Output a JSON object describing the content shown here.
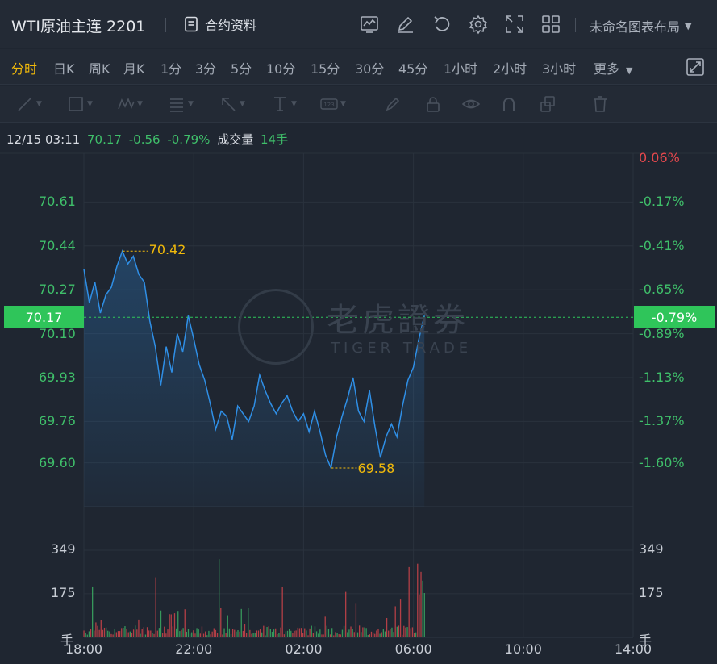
{
  "header": {
    "title": "WTI原油主连 2201",
    "contract_label": "合约资料",
    "layout_label": "未命名图表布局",
    "toolbar_icons": [
      "indicator-chart-icon",
      "edit-icon",
      "undo-icon",
      "settings-icon",
      "expand-icon",
      "grid-layout-icon"
    ]
  },
  "periods": {
    "items": [
      "分时",
      "日K",
      "周K",
      "月K",
      "1分",
      "3分",
      "5分",
      "10分",
      "15分",
      "30分",
      "45分",
      "1小时",
      "2小时",
      "3小时",
      "更多"
    ],
    "active": "分时"
  },
  "drawing_tools": [
    "line-tool-icon",
    "rectangle-tool-icon",
    "pattern-tool-icon",
    "fib-tool-icon",
    "arrow-tool-icon",
    "measure-tool-icon",
    "text-tool-icon",
    "brush-icon",
    "lock-icon",
    "eye-icon",
    "magnet-icon",
    "layers-icon",
    "trash-icon"
  ],
  "info": {
    "datetime": "12/15 03:11",
    "price": "70.17",
    "change": "-0.56",
    "change_pct": "-0.79%",
    "volume_label": "成交量",
    "volume_value": "14手"
  },
  "watermark": {
    "cn": "老虎證券",
    "en": "TIGER TRADE"
  },
  "colors": {
    "up": "#3fbf6a",
    "down": "#e5484d",
    "line": "#2f8fe6",
    "accent": "#f0b90b"
  },
  "chart_data": {
    "type": "line",
    "price_axis_left": [
      "70.61",
      "70.44",
      "70.27",
      "70.10",
      "69.93",
      "69.76",
      "69.60"
    ],
    "price_axis_right": [
      "0.06%",
      "-0.17%",
      "-0.41%",
      "-0.65%",
      "-0.89%",
      "-1.13%",
      "-1.37%",
      "-1.60%"
    ],
    "current_price_label": "70.17",
    "current_pct_label": "-0.79%",
    "high_label": "70.42",
    "low_label": "69.58",
    "ylim": [
      69.43,
      70.78
    ],
    "x_ticks": [
      "18:00",
      "22:00",
      "02:00",
      "06:00",
      "10:00",
      "14:00"
    ],
    "x_range_hours": [
      0,
      20
    ],
    "price_series": [
      [
        0.0,
        70.35
      ],
      [
        0.2,
        70.22
      ],
      [
        0.4,
        70.3
      ],
      [
        0.6,
        70.18
      ],
      [
        0.8,
        70.25
      ],
      [
        1.0,
        70.28
      ],
      [
        1.2,
        70.36
      ],
      [
        1.4,
        70.42
      ],
      [
        1.6,
        70.37
      ],
      [
        1.8,
        70.4
      ],
      [
        2.0,
        70.33
      ],
      [
        2.2,
        70.3
      ],
      [
        2.4,
        70.15
      ],
      [
        2.6,
        70.05
      ],
      [
        2.8,
        69.9
      ],
      [
        3.0,
        70.05
      ],
      [
        3.2,
        69.95
      ],
      [
        3.4,
        70.1
      ],
      [
        3.6,
        70.03
      ],
      [
        3.8,
        70.17
      ],
      [
        4.0,
        70.08
      ],
      [
        4.2,
        69.98
      ],
      [
        4.4,
        69.92
      ],
      [
        4.6,
        69.83
      ],
      [
        4.8,
        69.73
      ],
      [
        5.0,
        69.8
      ],
      [
        5.2,
        69.78
      ],
      [
        5.4,
        69.69
      ],
      [
        5.6,
        69.82
      ],
      [
        5.8,
        69.79
      ],
      [
        6.0,
        69.76
      ],
      [
        6.2,
        69.82
      ],
      [
        6.4,
        69.94
      ],
      [
        6.6,
        69.88
      ],
      [
        6.8,
        69.83
      ],
      [
        7.0,
        69.79
      ],
      [
        7.2,
        69.83
      ],
      [
        7.4,
        69.86
      ],
      [
        7.6,
        69.8
      ],
      [
        7.8,
        69.76
      ],
      [
        8.0,
        69.79
      ],
      [
        8.2,
        69.72
      ],
      [
        8.4,
        69.8
      ],
      [
        8.6,
        69.72
      ],
      [
        8.8,
        69.63
      ],
      [
        9.0,
        69.58
      ],
      [
        9.2,
        69.7
      ],
      [
        9.4,
        69.78
      ],
      [
        9.6,
        69.85
      ],
      [
        9.8,
        69.93
      ],
      [
        10.0,
        69.8
      ],
      [
        10.2,
        69.76
      ],
      [
        10.4,
        69.88
      ],
      [
        10.6,
        69.74
      ],
      [
        10.8,
        69.62
      ],
      [
        11.0,
        69.7
      ],
      [
        11.2,
        69.75
      ],
      [
        11.4,
        69.7
      ],
      [
        11.6,
        69.82
      ],
      [
        11.8,
        69.92
      ],
      [
        12.0,
        69.97
      ],
      [
        12.2,
        70.08
      ],
      [
        12.4,
        70.17
      ]
    ],
    "volume_axis": [
      "349",
      "175",
      "手"
    ],
    "volume_max": 349
  }
}
